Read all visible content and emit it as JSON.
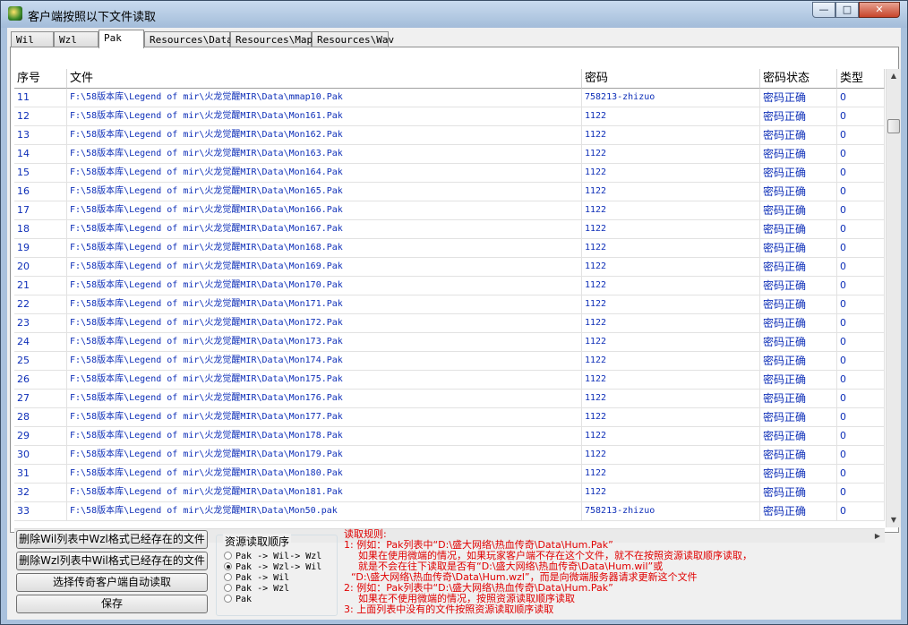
{
  "window": {
    "title": "客户端按照以下文件读取"
  },
  "titlebar_buttons": {
    "min": "—",
    "max": "□",
    "close": "✕"
  },
  "tabs": [
    "Wil",
    "Wzl",
    "Pak",
    "Resources\\Data",
    "Resources\\Map",
    "Resources\\Wav"
  ],
  "active_tab": "Pak",
  "table": {
    "columns": [
      "序号",
      "文件",
      "密码",
      "密码状态",
      "类型"
    ],
    "rows": [
      [
        "11",
        "F:\\58版本库\\Legend of mir\\火龙觉醒MIR\\Data\\mmap10.Pak",
        "758213-zhizuo",
        "密码正确",
        "0"
      ],
      [
        "12",
        "F:\\58版本库\\Legend of mir\\火龙觉醒MIR\\Data\\Mon161.Pak",
        "1122",
        "密码正确",
        "0"
      ],
      [
        "13",
        "F:\\58版本库\\Legend of mir\\火龙觉醒MIR\\Data\\Mon162.Pak",
        "1122",
        "密码正确",
        "0"
      ],
      [
        "14",
        "F:\\58版本库\\Legend of mir\\火龙觉醒MIR\\Data\\Mon163.Pak",
        "1122",
        "密码正确",
        "0"
      ],
      [
        "15",
        "F:\\58版本库\\Legend of mir\\火龙觉醒MIR\\Data\\Mon164.Pak",
        "1122",
        "密码正确",
        "0"
      ],
      [
        "16",
        "F:\\58版本库\\Legend of mir\\火龙觉醒MIR\\Data\\Mon165.Pak",
        "1122",
        "密码正确",
        "0"
      ],
      [
        "17",
        "F:\\58版本库\\Legend of mir\\火龙觉醒MIR\\Data\\Mon166.Pak",
        "1122",
        "密码正确",
        "0"
      ],
      [
        "18",
        "F:\\58版本库\\Legend of mir\\火龙觉醒MIR\\Data\\Mon167.Pak",
        "1122",
        "密码正确",
        "0"
      ],
      [
        "19",
        "F:\\58版本库\\Legend of mir\\火龙觉醒MIR\\Data\\Mon168.Pak",
        "1122",
        "密码正确",
        "0"
      ],
      [
        "20",
        "F:\\58版本库\\Legend of mir\\火龙觉醒MIR\\Data\\Mon169.Pak",
        "1122",
        "密码正确",
        "0"
      ],
      [
        "21",
        "F:\\58版本库\\Legend of mir\\火龙觉醒MIR\\Data\\Mon170.Pak",
        "1122",
        "密码正确",
        "0"
      ],
      [
        "22",
        "F:\\58版本库\\Legend of mir\\火龙觉醒MIR\\Data\\Mon171.Pak",
        "1122",
        "密码正确",
        "0"
      ],
      [
        "23",
        "F:\\58版本库\\Legend of mir\\火龙觉醒MIR\\Data\\Mon172.Pak",
        "1122",
        "密码正确",
        "0"
      ],
      [
        "24",
        "F:\\58版本库\\Legend of mir\\火龙觉醒MIR\\Data\\Mon173.Pak",
        "1122",
        "密码正确",
        "0"
      ],
      [
        "25",
        "F:\\58版本库\\Legend of mir\\火龙觉醒MIR\\Data\\Mon174.Pak",
        "1122",
        "密码正确",
        "0"
      ],
      [
        "26",
        "F:\\58版本库\\Legend of mir\\火龙觉醒MIR\\Data\\Mon175.Pak",
        "1122",
        "密码正确",
        "0"
      ],
      [
        "27",
        "F:\\58版本库\\Legend of mir\\火龙觉醒MIR\\Data\\Mon176.Pak",
        "1122",
        "密码正确",
        "0"
      ],
      [
        "28",
        "F:\\58版本库\\Legend of mir\\火龙觉醒MIR\\Data\\Mon177.Pak",
        "1122",
        "密码正确",
        "0"
      ],
      [
        "29",
        "F:\\58版本库\\Legend of mir\\火龙觉醒MIR\\Data\\Mon178.Pak",
        "1122",
        "密码正确",
        "0"
      ],
      [
        "30",
        "F:\\58版本库\\Legend of mir\\火龙觉醒MIR\\Data\\Mon179.Pak",
        "1122",
        "密码正确",
        "0"
      ],
      [
        "31",
        "F:\\58版本库\\Legend of mir\\火龙觉醒MIR\\Data\\Mon180.Pak",
        "1122",
        "密码正确",
        "0"
      ],
      [
        "32",
        "F:\\58版本库\\Legend of mir\\火龙觉醒MIR\\Data\\Mon181.Pak",
        "1122",
        "密码正确",
        "0"
      ],
      [
        "33",
        "F:\\58版本库\\Legend of mir\\火龙觉醒MIR\\Data\\Mon50.pak",
        "758213-zhizuo",
        "密码正确",
        "0"
      ]
    ]
  },
  "buttons": {
    "delete_wil": "删除Wil列表中Wzl格式已经存在的文件",
    "delete_wzl": "删除Wzl列表中Wil格式已经存在的文件",
    "choose_client": "选择传奇客户端自动读取",
    "save": "保存"
  },
  "read_order": {
    "title": "资源读取顺序",
    "options": [
      "Pak -> Wil-> Wzl",
      "Pak -> Wzl-> Wil",
      "Pak -> Wil",
      "Pak -> Wzl",
      "Pak"
    ],
    "selected": "Pak -> Wzl-> Wil"
  },
  "rules": {
    "title": "读取规则:",
    "lines": [
      "1: 例如：Pak列表中“D:\\盛大网络\\热血传奇\\Data\\Hum.Pak”",
      "如果在使用微端的情况，如果玩家客户端不存在这个文件，就不在按照资源读取顺序读取，",
      "就是不会在往下读取是否有“D:\\盛大网络\\热血传奇\\Data\\Hum.wil”或",
      "“D:\\盛大网络\\热血传奇\\Data\\Hum.wzl”，而是向微端服务器请求更新这个文件",
      "2: 例如：Pak列表中“D:\\盛大网络\\热血传奇\\Data\\Hum.Pak”",
      "如果在不使用微端的情况，按照资源读取顺序读取",
      "3: 上面列表中没有的文件按照资源读取顺序读取"
    ]
  },
  "colors": {
    "cell_text": "#0e2fb8",
    "rules_text": "#e00000",
    "titlebar": "#a3bcd9"
  }
}
